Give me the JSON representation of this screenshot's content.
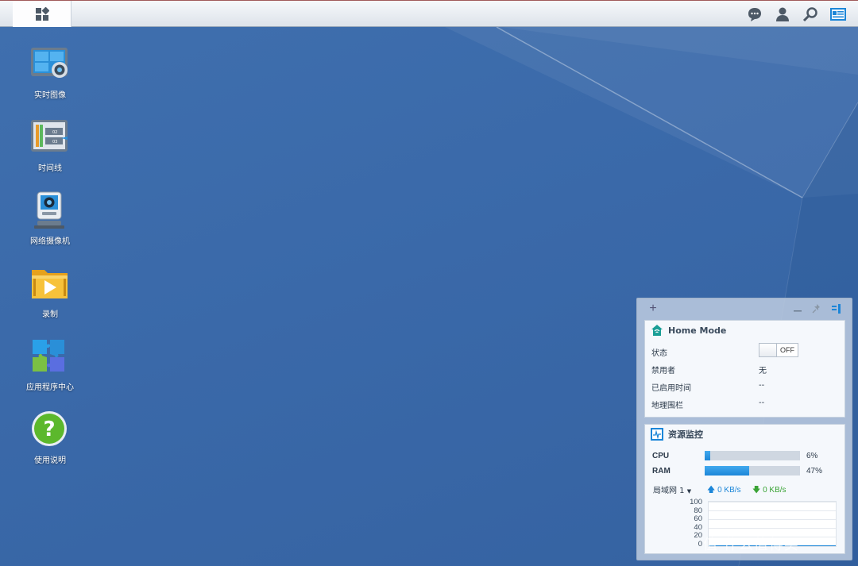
{
  "taskbar": {
    "main_menu_icon": "grid-icon",
    "right_icons": [
      "chat-icon",
      "user-icon",
      "search-icon",
      "widgets-icon"
    ]
  },
  "desktop": {
    "items": [
      {
        "label": "实时图像",
        "icon": "live-view-icon"
      },
      {
        "label": "时间线",
        "icon": "timeline-icon"
      },
      {
        "label": "网络摄像机",
        "icon": "ip-camera-icon"
      },
      {
        "label": "录制",
        "icon": "recording-folder-icon"
      },
      {
        "label": "应用程序中心",
        "icon": "puzzle-icon"
      },
      {
        "label": "使用说明",
        "icon": "help-icon"
      }
    ]
  },
  "widget_panel": {
    "add": "+",
    "home_mode": {
      "title": "Home Mode",
      "rows": {
        "status": {
          "label": "状态",
          "toggle": "OFF"
        },
        "disabled_by": {
          "label": "禁用者",
          "value": "无"
        },
        "enabled_time": {
          "label": "已启用时间",
          "value": "--"
        },
        "geofence": {
          "label": "地理围栏",
          "value": "--"
        }
      }
    },
    "resource_monitor": {
      "title": "资源监控",
      "cpu": {
        "label": "CPU",
        "percent": 6,
        "text": "6%"
      },
      "ram": {
        "label": "RAM",
        "percent": 47,
        "text": "47%"
      },
      "lan": {
        "label": "局域网 1",
        "up": "0 KB/s",
        "down": "0 KB/s"
      },
      "graph_ticks": [
        "100",
        "80",
        "60",
        "40",
        "20",
        "0"
      ]
    }
  },
  "colors": {
    "desktop": "#3a68a8",
    "accent_blue": "#1c86d8",
    "download_green": "#3aa335",
    "home_mode_teal": "#1a9e96"
  },
  "watermark": "值 什么值得买"
}
